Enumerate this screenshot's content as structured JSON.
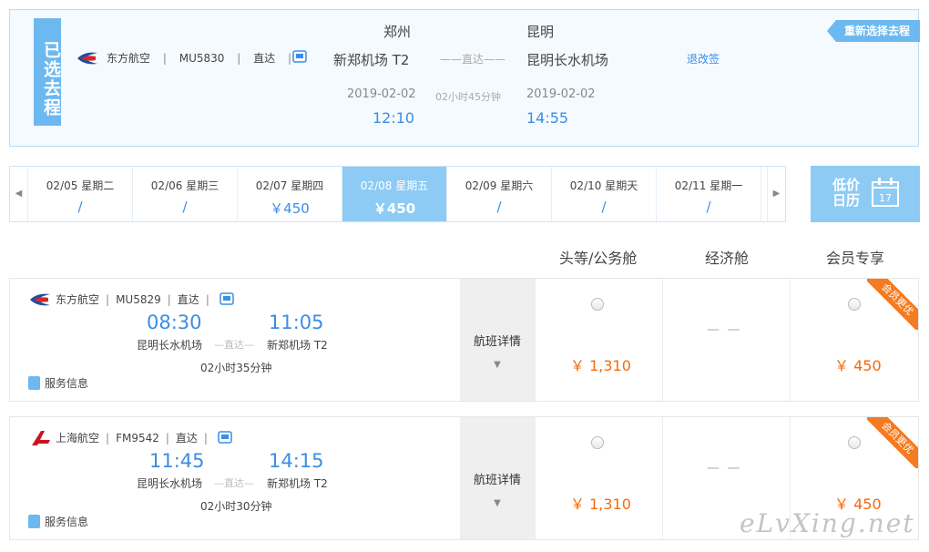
{
  "selected": {
    "tag": "已选去程",
    "airline": "东方航空",
    "flight_no": "MU5830",
    "type": "直达",
    "sep": "|",
    "from_city": "郑州",
    "to_city": "昆明",
    "from_airport": "新郑机场 T2",
    "to_airport": "昆明长水机场",
    "mid_label": "——直达——",
    "dep_date": "2019-02-02",
    "arr_date": "2019-02-02",
    "duration": "02小时45分钟",
    "dep_time": "12:10",
    "arr_time": "14:55",
    "refund_link": "退改签",
    "reselect_button": "重新选择去程"
  },
  "date_bar": {
    "days": [
      {
        "date": "02/05 星期二",
        "price": "/"
      },
      {
        "date": "02/06 星期三",
        "price": "/"
      },
      {
        "date": "02/07 星期四",
        "price": "￥450"
      },
      {
        "date": "02/08 星期五",
        "price": "￥450",
        "active": true
      },
      {
        "date": "02/09 星期六",
        "price": "/"
      },
      {
        "date": "02/10 星期天",
        "price": "/"
      },
      {
        "date": "02/11 星期一",
        "price": "/"
      }
    ],
    "calendar_label_1": "低价",
    "calendar_label_2": "日历",
    "calendar_day": "17"
  },
  "columns": {
    "first": "头等/公务舱",
    "economy": "经济舱",
    "member": "会员专享"
  },
  "flights": [
    {
      "airline": "东方航空",
      "flight_no": "MU5829",
      "type": "直达",
      "dep_time": "08:30",
      "arr_time": "11:05",
      "dep_airport": "昆明长水机场",
      "arr_airport": "新郑机场 T2",
      "mid_label": "—直达—",
      "duration": "02小时35分钟",
      "service": "服务信息",
      "detail": "航班详情",
      "first_price": "￥ 1,310",
      "economy": "— —",
      "member_price": "￥ 450",
      "ribbon": "会员更优"
    },
    {
      "airline": "上海航空",
      "flight_no": "FM9542",
      "type": "直达",
      "dep_time": "11:45",
      "arr_time": "14:15",
      "dep_airport": "昆明长水机场",
      "arr_airport": "新郑机场 T2",
      "mid_label": "—直达—",
      "duration": "02小时30分钟",
      "service": "服务信息",
      "detail": "航班详情",
      "first_price": "￥ 1,310",
      "economy": "— —",
      "member_price": "￥ 450",
      "ribbon": "会员更优"
    }
  ],
  "watermark": "eLvXing.net",
  "colors": {
    "accent": "#3a8ee6",
    "price": "#f46a0d",
    "tag": "#6cb8f0",
    "ribbon": "#f47b20"
  }
}
